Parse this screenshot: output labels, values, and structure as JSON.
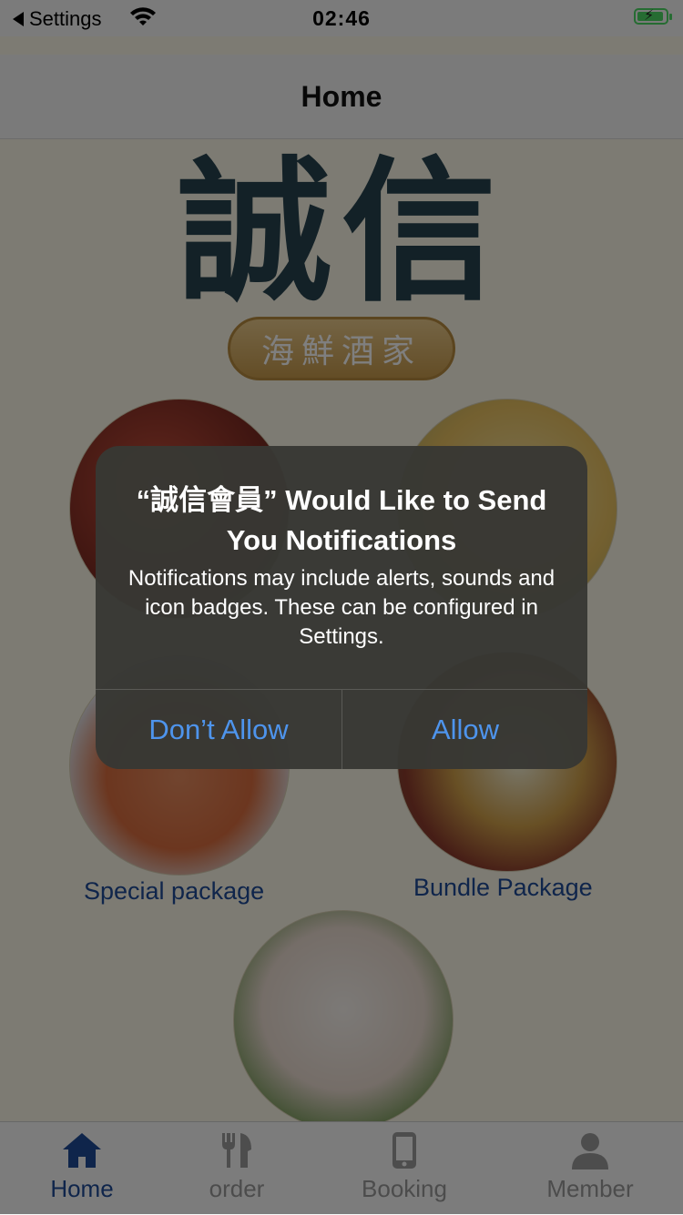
{
  "status_bar": {
    "back_label": "Settings",
    "time": "02:46",
    "icons": [
      "back-triangle-icon",
      "wifi-icon",
      "battery-charging-icon"
    ]
  },
  "nav": {
    "title": "Home"
  },
  "logo": {
    "main_text": "誠信",
    "sub_text": "海鮮酒家"
  },
  "menu": {
    "items": [
      {
        "label": ""
      },
      {
        "label": ""
      },
      {
        "label": "Special package"
      },
      {
        "label": "Bundle Package"
      },
      {
        "label": ""
      }
    ]
  },
  "tabs": [
    {
      "label": "Home",
      "icon": "home-icon",
      "active": true
    },
    {
      "label": "order",
      "icon": "utensils-icon",
      "active": false
    },
    {
      "label": "Booking",
      "icon": "phone-icon",
      "active": false
    },
    {
      "label": "Member",
      "icon": "person-icon",
      "active": false
    }
  ],
  "alert": {
    "title": "“誠信會員” Would Like to Send You Notifications",
    "message": "Notifications may include alerts, sounds and icon badges. These can be configured in Settings.",
    "buttons": {
      "dont_allow": "Don’t Allow",
      "allow": "Allow"
    }
  },
  "colors": {
    "accent": "#1f4a96",
    "alert_button": "#4e94ec",
    "battery": "#4cd964"
  }
}
